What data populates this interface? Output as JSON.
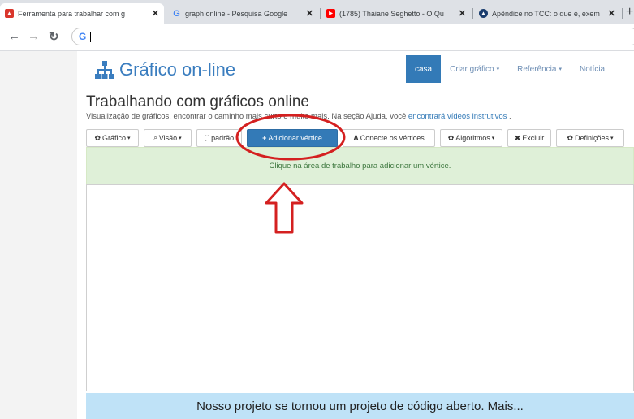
{
  "browser": {
    "tabs": [
      {
        "title": "Ferramenta para trabalhar com g",
        "favicon": "graph-online-favicon",
        "favicon_color": "#d9362c",
        "active": true
      },
      {
        "title": "graph online - Pesquisa Google",
        "favicon": "google-icon",
        "favicon_color": "#4285f4",
        "active": false
      },
      {
        "title": "(1785) Thaiane Seghetto - O Qu",
        "favicon": "youtube-icon",
        "favicon_color": "#ff0000",
        "active": false
      },
      {
        "title": "Apêndice no TCC: o que é, exem",
        "favicon": "mortarboard-icon",
        "favicon_color": "#1a3d6e",
        "active": false
      }
    ],
    "new_tab": "+",
    "address_value": ""
  },
  "site": {
    "brand": "Gráfico on-line",
    "nav": [
      {
        "label": "casa",
        "active": true
      },
      {
        "label": "Criar gráfico",
        "caret": true
      },
      {
        "label": "Referência",
        "caret": true
      },
      {
        "label": "Notícia"
      }
    ],
    "heading": "Trabalhando com gráficos online",
    "subtext_before": "Visualização de gráficos, encontrar o caminho mais curto e muito mais. Na seção Ajuda, você ",
    "subtext_link": "encontrará vídeos instrutivos",
    "subtext_after": " .",
    "toolbar": [
      {
        "icon": "gear-icon",
        "glyph": "✿",
        "label": "Gráfico",
        "caret": true
      },
      {
        "icon": "zoom-icon",
        "glyph": "🔍",
        "label": "Visão",
        "caret": true
      },
      {
        "icon": "expand-icon",
        "glyph": "⛶",
        "label": "padrão",
        "caret": false
      },
      {
        "icon": "plus-icon",
        "glyph": "+",
        "label": "Adicionar vértice",
        "caret": false,
        "primary": true
      },
      {
        "icon": "connect-icon",
        "glyph": "A",
        "label": "Conecte os vértices",
        "caret": false
      },
      {
        "icon": "gear-icon",
        "glyph": "✿",
        "label": "Algoritmos",
        "caret": true
      },
      {
        "icon": "delete-icon",
        "glyph": "✖",
        "label": "Excluir",
        "caret": false
      },
      {
        "icon": "gear-icon",
        "glyph": "✿",
        "label": "Definições",
        "caret": true
      }
    ],
    "alert": "Clique na área de trabalho para adicionar um vértice.",
    "footer_banner": "Nosso projeto se tornou um projeto de código aberto. Mais..."
  },
  "colors": {
    "primary": "#337ab7",
    "alert_bg": "#dff0d8",
    "banner_bg": "#bfe2f7",
    "annotation_red": "#d42020"
  }
}
